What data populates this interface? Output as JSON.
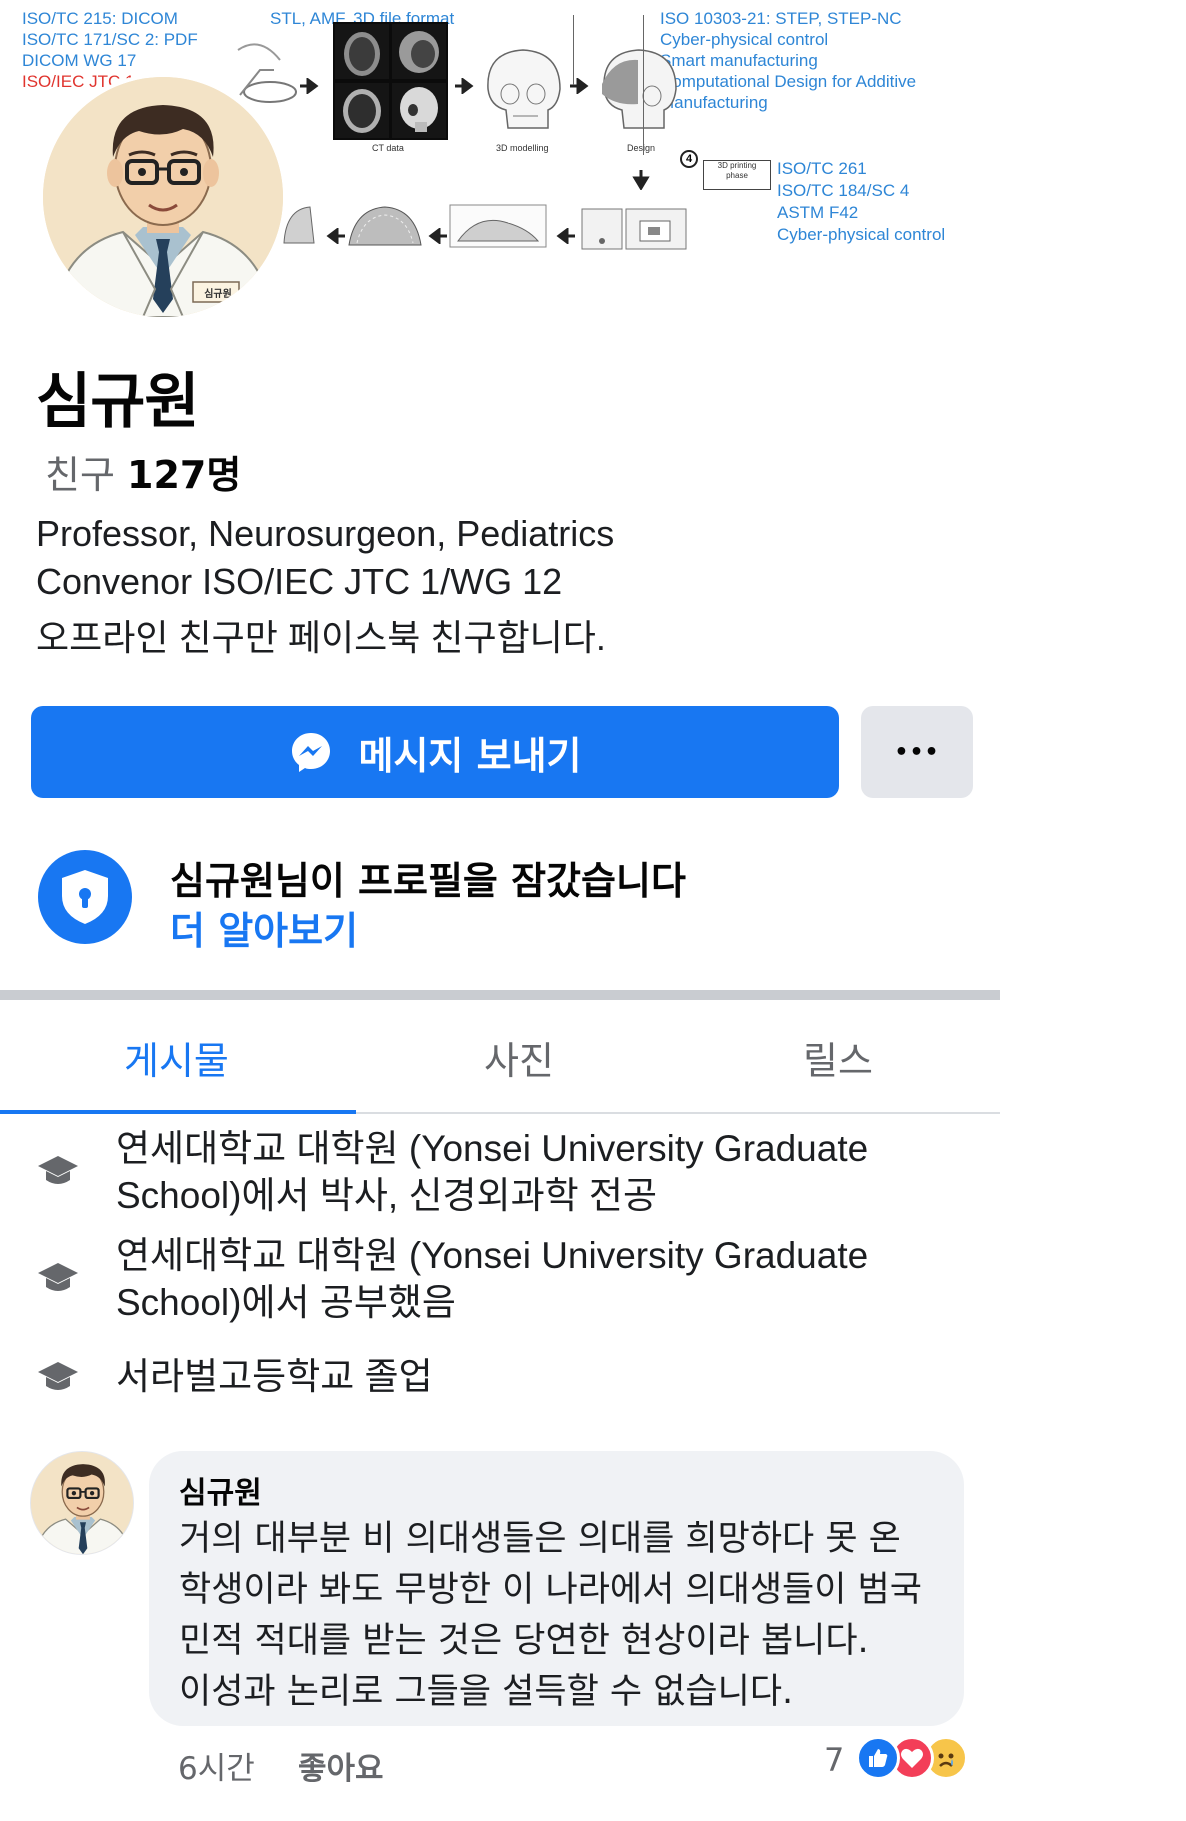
{
  "cover": {
    "left_labels": [
      "ISO/TC 215: DICOM",
      "ISO/TC 171/SC 2: PDF",
      "DICOM WG 17",
      "ISO/IEC JTC 1"
    ],
    "top_label": "STL, AMF, 3D file format",
    "right_top_labels": [
      "ISO 10303-21: STEP, STEP-NC",
      "Cyber-physical control",
      "Smart manufacturing",
      "Computational Design for Additive",
      "Manufacturing"
    ],
    "right_bottom_labels": [
      "ISO/TC 261",
      "ISO/TC 184/SC 4",
      "ASTM F42",
      "Cyber-physical control"
    ],
    "captions": {
      "ct": "CT data",
      "modelling": "3D modelling",
      "design": "Design",
      "step": "4",
      "printing_1": "3D printing",
      "printing_2": "phase"
    },
    "avatar_badge": "심규원"
  },
  "profile": {
    "name": "심규원",
    "friends_label": "친구",
    "friends_count": "127명",
    "bio": [
      "Professor, Neurosurgeon, Pediatrics",
      "Convenor ISO/IEC JTC 1/WG 12",
      "오프라인 친구만 페이스북 친구합니다."
    ]
  },
  "actions": {
    "message_label": "메시지 보내기",
    "more_label": "•••"
  },
  "locked": {
    "title": "심규원님이 프로필을 잠갔습니다",
    "link": "더 알아보기"
  },
  "tabs": [
    {
      "label": "게시물",
      "active": true
    },
    {
      "label": "사진",
      "active": false
    },
    {
      "label": "릴스",
      "active": false
    }
  ],
  "education": [
    {
      "line1": "연세대학교 대학원 (Yonsei University Graduate",
      "line2": "School)에서 박사, 신경외과학 전공",
      "icon": "graduation-cap-icon"
    },
    {
      "line1": "연세대학교 대학원 (Yonsei University Graduate",
      "line2": "School)에서 공부했음",
      "icon": "graduation-cap-icon"
    },
    {
      "line1": "서라벌고등학교 졸업",
      "line2": "",
      "icon": "graduation-cap-icon"
    }
  ],
  "comment": {
    "author": "심규원",
    "lines": [
      "거의 대부분 비 의대생들은 의대를 희망하다 못 온",
      "학생이라 봐도 무방한 이 나라에서 의대생들이 범국",
      "민적 적대를 받는 것은 당연한 현상이라 봅니다.",
      "이성과 논리로 그들을 설득할 수 없습니다."
    ],
    "time": "6시간",
    "like_label": "좋아요",
    "reaction_count": "7",
    "reactions": [
      "like-icon",
      "love-icon",
      "sad-icon"
    ]
  },
  "colors": {
    "accent": "#1877f2",
    "secondary_text": "#65676b",
    "bubble": "#f0f2f5",
    "divider": "#c9ccd1",
    "cover_blue": "#2e86d6",
    "cover_red": "#e0342e"
  }
}
